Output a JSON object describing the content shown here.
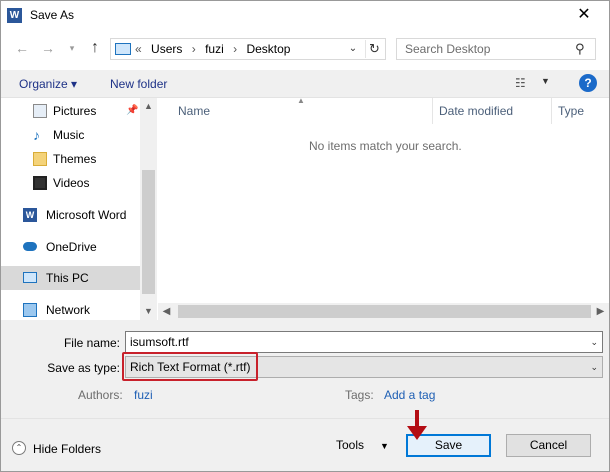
{
  "window": {
    "title": "Save As",
    "app_icon": "word-icon",
    "close_label": "✕"
  },
  "addressbar": {
    "crumbs": [
      "«",
      "Users",
      "›",
      "fuzi",
      "›",
      "Desktop"
    ],
    "search_placeholder": "Search Desktop"
  },
  "toolbar": {
    "organize_label": "Organize ▾",
    "new_folder_label": "New folder",
    "help_label": "?"
  },
  "navpane": {
    "items": [
      {
        "label": "Pictures",
        "icon": "pictures-icon"
      },
      {
        "label": "Music",
        "icon": "music-icon"
      },
      {
        "label": "Themes",
        "icon": "folder-icon"
      },
      {
        "label": "Videos",
        "icon": "videos-icon"
      },
      {
        "label": "Microsoft Word",
        "icon": "word-icon"
      },
      {
        "label": "OneDrive",
        "icon": "onedrive-icon"
      },
      {
        "label": "This PC",
        "icon": "this-pc-icon"
      },
      {
        "label": "Network",
        "icon": "network-icon"
      }
    ]
  },
  "content": {
    "columns": [
      "Name",
      "Date modified",
      "Type"
    ],
    "empty_message": "No items match your search."
  },
  "form": {
    "file_name_label": "File name:",
    "file_name_value": "isumsoft.rtf",
    "save_type_label": "Save as type:",
    "save_type_value": "Rich Text Format (*.rtf)",
    "authors_label": "Authors:",
    "authors_value": "fuzi",
    "tags_label": "Tags:",
    "tags_value": "Add a tag"
  },
  "footer": {
    "hide_folders_label": "Hide Folders",
    "tools_label": "Tools",
    "save_label": "Save",
    "cancel_label": "Cancel"
  },
  "colors": {
    "accent": "#0078d7",
    "link": "#1e5fb4",
    "highlight_box": "#c8212b",
    "annotation_arrow": "#b40d14"
  }
}
